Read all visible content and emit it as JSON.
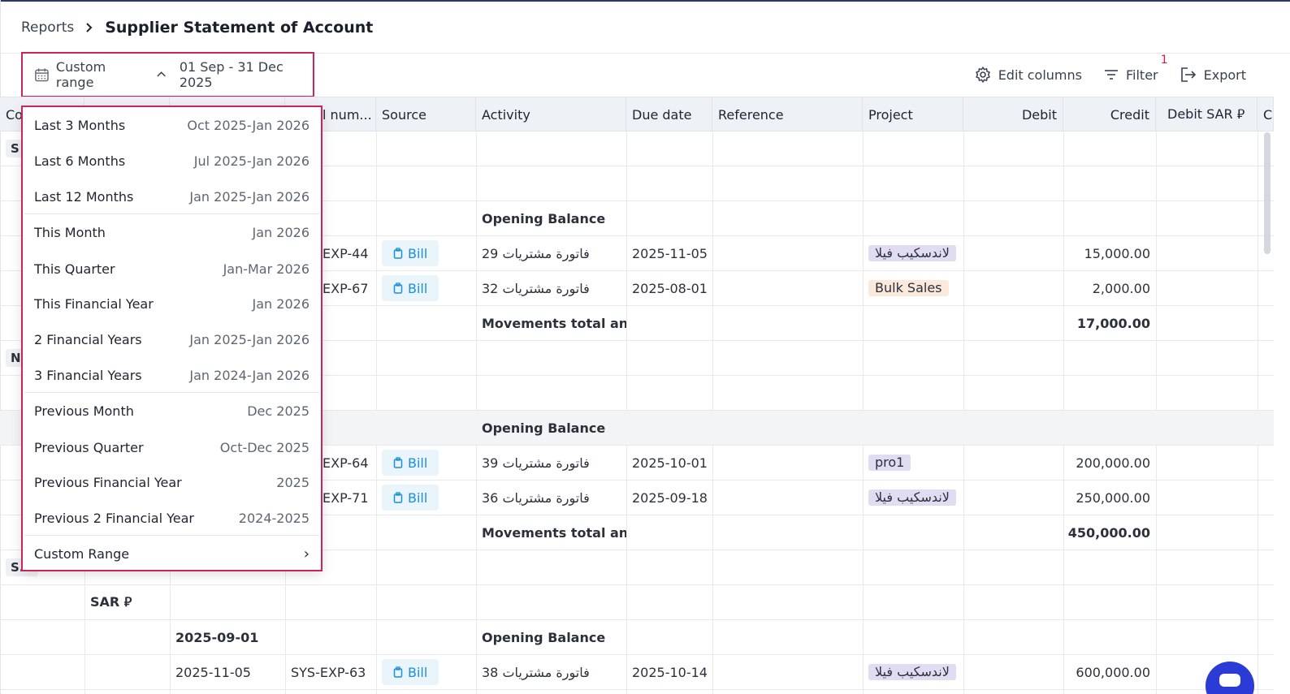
{
  "breadcrumb": {
    "parent": "Reports",
    "title": "Supplier Statement of Account"
  },
  "range_picker": {
    "label": "Custom range",
    "value": "01 Sep - 31 Dec 2025"
  },
  "toolbar": {
    "edit_columns": "Edit columns",
    "filter": "Filter",
    "filter_count": "1",
    "export": "Export"
  },
  "columns": [
    "Co",
    "",
    "",
    "l num...",
    "Source",
    "Activity",
    "Due date",
    "Reference",
    "Project",
    "Debit",
    "Credit",
    "Debit SAR ⃁",
    "C"
  ],
  "group_labels": {
    "g1": "S",
    "g2": "N",
    "g3": "Supp",
    "g3_visible": "S...",
    "currency": "SAR ⃁"
  },
  "rows": [
    {
      "activity": "Opening Balance"
    },
    {
      "num": "EXP-44",
      "source": "Bill",
      "activity": "فاتورة مشتريات 29",
      "due": "2025-11-05",
      "project": "لاندسكيب فيلا",
      "credit": "15,000.00"
    },
    {
      "num": "EXP-67",
      "source": "Bill",
      "activity": "فاتورة مشتريات 32",
      "due": "2025-08-01",
      "project": "Bulk Sales",
      "credit": "2,000.00"
    },
    {
      "activity": "Movements total and b",
      "credit": "17,000.00"
    },
    {
      "activity": "Opening Balance"
    },
    {
      "num": "EXP-64",
      "source": "Bill",
      "activity": "فاتورة مشتريات 39",
      "due": "2025-10-01",
      "project": "pro1",
      "credit": "200,000.00"
    },
    {
      "num": "EXP-71",
      "source": "Bill",
      "activity": "فاتورة مشتريات 36",
      "due": "2025-09-18",
      "project": "لاندسكيب فيلا",
      "credit": "250,000.00"
    },
    {
      "activity": "Movements total and b",
      "credit": "450,000.00"
    },
    {
      "date": "2025-09-01",
      "activity": "Opening Balance"
    },
    {
      "date": "2025-11-05",
      "num": "SYS-EXP-63",
      "source": "Bill",
      "activity": "فاتورة مشتريات 38",
      "due": "2025-10-14",
      "project": "لاندسكيب فيلا",
      "credit": "600,000.00"
    }
  ],
  "dropdown": [
    {
      "name": "Last 3 Months",
      "range": "Oct 2025-Jan 2026"
    },
    {
      "name": "Last 6 Months",
      "range": "Jul 2025-Jan 2026"
    },
    {
      "name": "Last 12 Months",
      "range": "Jan 2025-Jan 2026"
    },
    {
      "name": "This Month",
      "range": "Jan 2026"
    },
    {
      "name": "This Quarter",
      "range": "Jan-Mar 2026"
    },
    {
      "name": "This Financial Year",
      "range": "Jan 2026"
    },
    {
      "name": "2 Financial Years",
      "range": "Jan 2025-Jan 2026"
    },
    {
      "name": "3 Financial Years",
      "range": "Jan 2024-Jan 2026"
    },
    {
      "name": "Previous Month",
      "range": "Dec 2025"
    },
    {
      "name": "Previous Quarter",
      "range": "Oct-Dec 2025"
    },
    {
      "name": "Previous Financial Year",
      "range": "2025"
    },
    {
      "name": "Previous 2 Financial Year",
      "range": "2024-2025"
    },
    {
      "name": "Custom Range",
      "range": "›"
    }
  ]
}
